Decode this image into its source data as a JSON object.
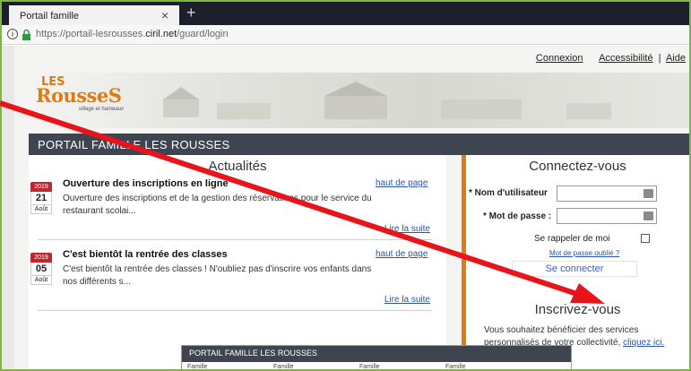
{
  "browser": {
    "tab_title": "Portail famille",
    "close_glyph": "×",
    "new_tab_glyph": "+",
    "url_prefix": "https://portail-lesrousses.",
    "url_domain": "ciril.net",
    "url_path": "/guard/login"
  },
  "header": {
    "links": [
      "Connexion",
      "Accessibilité",
      "Aide"
    ],
    "separator": "|",
    "logo_les": "LES",
    "logo_rousses": "RousseS",
    "logo_tagline": "village et hameaux",
    "portal_title": "PORTAIL FAMILLE LES ROUSSES"
  },
  "news": {
    "heading": "Actualités",
    "items": [
      {
        "year": "2019",
        "day": "21",
        "month": "Août",
        "title": "Ouverture des inscriptions en ligne",
        "text": "Ouverture des inscriptions et de la gestion des réservations pour le service du restaurant scolai...",
        "top_link": "haut de page",
        "more_link": "Lire la suite"
      },
      {
        "year": "2019",
        "day": "05",
        "month": "Août",
        "title": "C'est bientôt la rentrée des classes",
        "text": "C'est bientôt la rentrée des classes ! N'oubliez pas d'inscrire vos enfants dans nos différents s...",
        "top_link": "haut de page",
        "more_link": "Lire la suite"
      }
    ]
  },
  "login": {
    "heading": "Connectez-vous",
    "username_label": "* Nom d'utilisateur",
    "password_label": "* Mot de passe :",
    "remember_label": "Se rappeler de moi",
    "forgot_link": "Mot de passe oublié ?",
    "submit_label": "Se connecter"
  },
  "register": {
    "heading": "Inscrivez-vous",
    "text": "Vous souhaitez bénéficier des services personnalisés de votre collectivité,",
    "link": "cliquez ici."
  },
  "preview": {
    "title": "PORTAIL FAMILLE LES ROUSSES",
    "cells": [
      "Famille",
      "Famille",
      "Famille",
      "Famille"
    ]
  },
  "colors": {
    "accent": "#e07b10",
    "nav": "#3f4550",
    "arrow": "#e8141a",
    "link": "#2a55a5",
    "frame": "#7fb63f"
  }
}
